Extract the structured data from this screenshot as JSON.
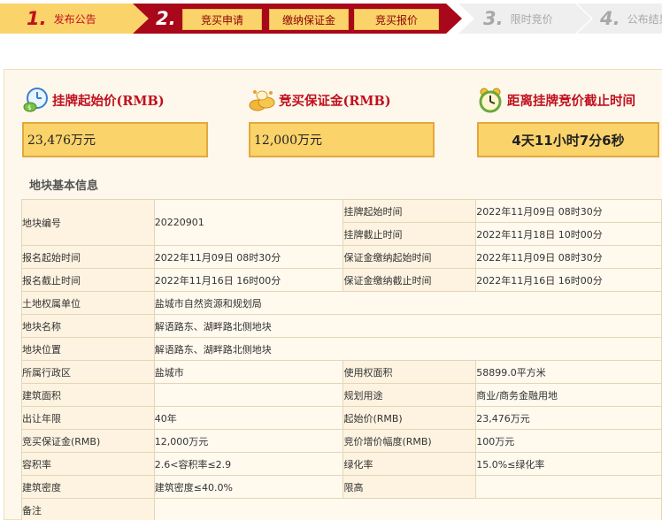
{
  "steps": {
    "s1": {
      "num": "1.",
      "label": "发布公告"
    },
    "s2": {
      "num": "2.",
      "tabs": [
        "竞买申请",
        "缴纳保证金",
        "竞买报价"
      ]
    },
    "s3": {
      "num": "3.",
      "label": "限时竞价"
    },
    "s4": {
      "num": "4.",
      "label": "公布结果"
    }
  },
  "summary": {
    "start_price": {
      "title": "挂牌起始价(RMB)",
      "value": "23,476万元",
      "icon": "money-clock-icon"
    },
    "deposit": {
      "title": "竞买保证金(RMB)",
      "value": "12,000万元",
      "icon": "gold-coins-icon"
    },
    "countdown": {
      "title": "距离挂牌竞价截止时间",
      "value": "4天11小时7分6秒",
      "icon": "alarm-clock-icon"
    }
  },
  "section_title": "地块基本信息",
  "table": {
    "r1": {
      "k1": "地块编号",
      "v1": "20220901",
      "k2a": "挂牌起始时间",
      "v2a": "2022年11月09日 08时30分",
      "k2b": "挂牌截止时间",
      "v2b": "2022年11月18日 10时00分"
    },
    "r3": {
      "k1": "报名起始时间",
      "v1": "2022年11月09日 08时30分",
      "k2": "保证金缴纳起始时间",
      "v2": "2022年11月09日 08时30分"
    },
    "r4": {
      "k1": "报名截止时间",
      "v1": "2022年11月16日 16时00分",
      "k2": "保证金缴纳截止时间",
      "v2": "2022年11月16日 16时00分"
    },
    "r5": {
      "k": "土地权属单位",
      "v": "盐城市自然资源和规划局"
    },
    "r6": {
      "k": "地块名称",
      "v": "解语路东、湖畔路北侧地块"
    },
    "r7": {
      "k": "地块位置",
      "v": "解语路东、湖畔路北侧地块"
    },
    "r8": {
      "k1": "所属行政区",
      "v1": "盐城市",
      "k2": "使用权面积",
      "v2": "58899.0平方米"
    },
    "r9": {
      "k1": "建筑面积",
      "v1": "",
      "k2": "规划用途",
      "v2": "商业/商务金融用地"
    },
    "r10": {
      "k1": "出让年限",
      "v1": "40年",
      "k2": "起始价(RMB)",
      "v2": "23,476万元"
    },
    "r11": {
      "k1": "竞买保证金(RMB)",
      "v1": "12,000万元",
      "k2": "竞价增价幅度(RMB)",
      "v2": "100万元"
    },
    "r12": {
      "k1": "容积率",
      "v1": "2.6<容积率≤2.9",
      "k2": "绿化率",
      "v2": "15.0%≤绿化率"
    },
    "r13": {
      "k1": "建筑密度",
      "v1": "建筑密度≤40.0%",
      "k2": "限高",
      "v2": ""
    },
    "r14": {
      "k1": "备注",
      "v1": ""
    }
  }
}
